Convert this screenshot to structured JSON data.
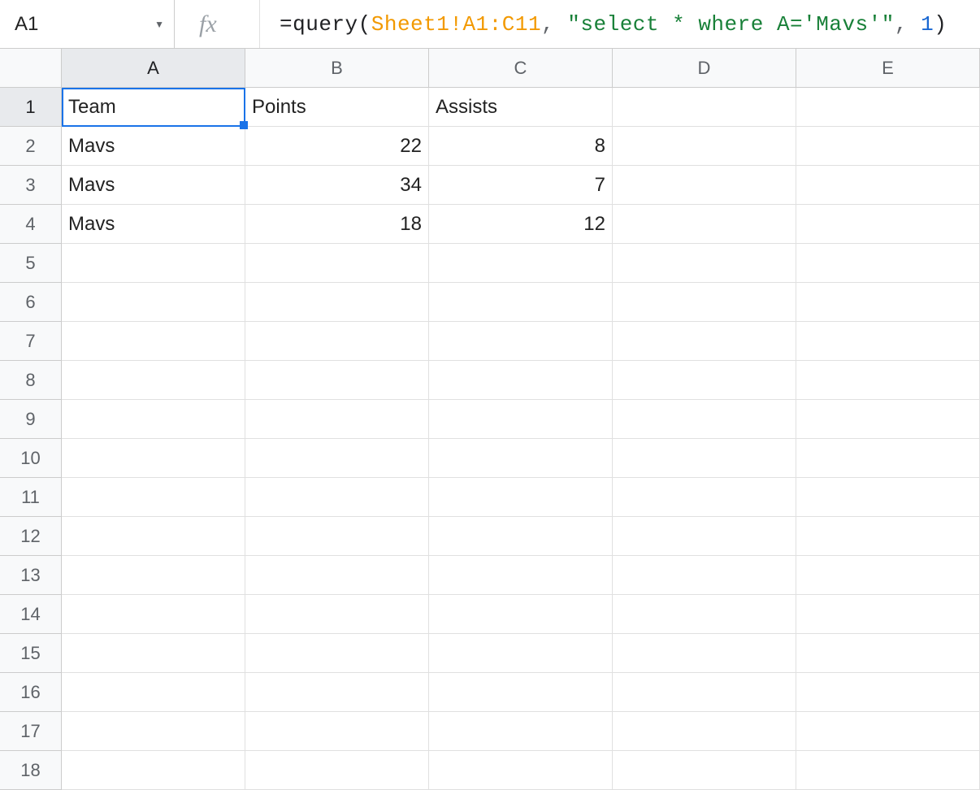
{
  "nameBox": "A1",
  "formula": {
    "tokens": [
      {
        "t": "=",
        "c": "black"
      },
      {
        "t": "query",
        "c": "black"
      },
      {
        "t": "(",
        "c": "black"
      },
      {
        "t": "Sheet1!A1:C11",
        "c": "orange"
      },
      {
        "t": ", ",
        "c": "gray"
      },
      {
        "t": "\"select * where A='Mavs'\"",
        "c": "green"
      },
      {
        "t": ", ",
        "c": "gray"
      },
      {
        "t": "1",
        "c": "blue"
      },
      {
        "t": ")",
        "c": "black"
      }
    ]
  },
  "columns": [
    "A",
    "B",
    "C",
    "D",
    "E"
  ],
  "activeColumn": "A",
  "activeRow": 1,
  "rowCount": 18,
  "colWidths": {
    "A": 226,
    "B": 226,
    "C": 226,
    "D": 226,
    "E": 226
  },
  "cells": {
    "A1": {
      "v": "Team",
      "align": "left"
    },
    "B1": {
      "v": "Points",
      "align": "left"
    },
    "C1": {
      "v": "Assists",
      "align": "left"
    },
    "A2": {
      "v": "Mavs",
      "align": "left"
    },
    "B2": {
      "v": "22",
      "align": "right"
    },
    "C2": {
      "v": "8",
      "align": "right"
    },
    "A3": {
      "v": "Mavs",
      "align": "left"
    },
    "B3": {
      "v": "34",
      "align": "right"
    },
    "C3": {
      "v": "7",
      "align": "right"
    },
    "A4": {
      "v": "Mavs",
      "align": "left"
    },
    "B4": {
      "v": "18",
      "align": "right"
    },
    "C4": {
      "v": "12",
      "align": "right"
    }
  },
  "selection": {
    "col": "A",
    "row": 1
  }
}
